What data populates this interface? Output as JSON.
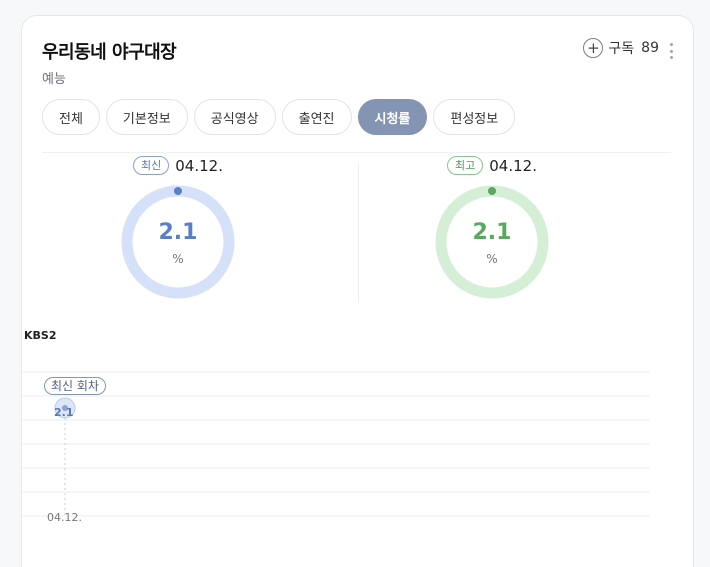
{
  "program": {
    "title": "우리동네 야구대장",
    "genre": "예능",
    "subscribe_label": "구독",
    "subscribe_count": "89"
  },
  "tabs": [
    {
      "label": "전체",
      "active": false
    },
    {
      "label": "기본정보",
      "active": false
    },
    {
      "label": "공식영상",
      "active": false
    },
    {
      "label": "출연진",
      "active": false
    },
    {
      "label": "시청률",
      "active": true
    },
    {
      "label": "편성정보",
      "active": false
    }
  ],
  "ratings": {
    "latest": {
      "badge": "최신",
      "date": "04.12.",
      "value": "2.1",
      "unit": "%",
      "color": "#5a7fc7",
      "track": "#d4e1f8"
    },
    "highest": {
      "badge": "최고",
      "date": "04.12.",
      "value": "2.1",
      "unit": "%",
      "color": "#59a861",
      "track": "#d4efd6"
    }
  },
  "network": "KBS2",
  "chart_data": {
    "type": "line",
    "categories": [
      "04.12."
    ],
    "series": [
      {
        "values": [
          2.1
        ]
      }
    ],
    "annotations": [
      {
        "text": "최신 회차",
        "x": "04.12."
      }
    ],
    "grid": true
  },
  "icons": {
    "subscribe": "plus-circle-icon",
    "more": "more-vertical-icon"
  }
}
